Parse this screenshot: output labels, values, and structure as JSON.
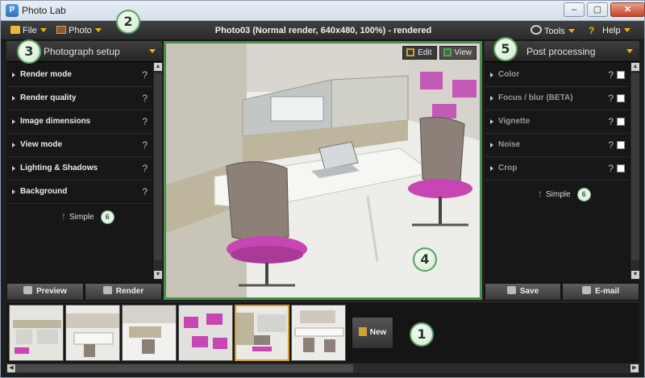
{
  "window": {
    "title": "Photo Lab",
    "app_icon_letter": "P",
    "controls": [
      "–",
      "▢",
      "✕"
    ]
  },
  "menubar": {
    "file": "File",
    "photo": "Photo",
    "status": "Photo03 (Normal render, 640x480, 100%) - rendered",
    "tools": "Tools",
    "help": "Help"
  },
  "left_panel": {
    "title": "Photograph setup",
    "rows": [
      {
        "label": "Render mode",
        "help": "?"
      },
      {
        "label": "Render quality",
        "help": "?"
      },
      {
        "label": "Image dimensions",
        "help": "?"
      },
      {
        "label": "View mode",
        "help": "?"
      },
      {
        "label": "Lighting & Shadows",
        "help": "?"
      },
      {
        "label": "Background",
        "help": "?"
      }
    ],
    "simple_label": "Simple",
    "simple_badge": "6",
    "preview_label": "Preview",
    "render_label": "Render"
  },
  "viewport": {
    "edit_label": "Edit",
    "view_label": "View"
  },
  "right_panel": {
    "title": "Post processing",
    "rows": [
      {
        "label": "Color",
        "help": "?"
      },
      {
        "label": "Focus / blur (BETA)",
        "help": "?"
      },
      {
        "label": "Vignette",
        "help": "?"
      },
      {
        "label": "Noise",
        "help": "?"
      },
      {
        "label": "Crop",
        "help": "?"
      }
    ],
    "simple_label": "Simple",
    "simple_badge": "6",
    "save_label": "Save",
    "email_label": "E-mail"
  },
  "filmstrip": {
    "thumbnail_count": 6,
    "selected_index": 4,
    "new_label": "New"
  },
  "callouts": [
    "1",
    "2",
    "3",
    "4",
    "5"
  ],
  "colors": {
    "accent_green": "#4a8f4e",
    "caret_yellow": "#f2b800",
    "selection_orange": "#d6a030"
  }
}
